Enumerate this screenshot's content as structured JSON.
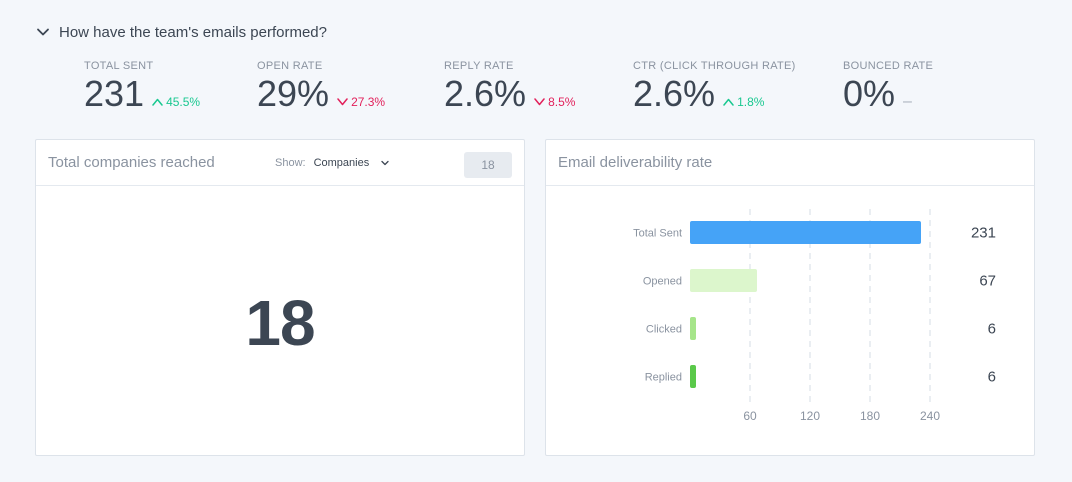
{
  "section": {
    "title": "How have the team's emails performed?",
    "icon": "chevron-down-icon"
  },
  "stats": [
    {
      "label": "TOTAL SENT",
      "value": "231",
      "delta": "45.5%",
      "direction": "up"
    },
    {
      "label": "OPEN RATE",
      "value": "29%",
      "delta": "27.3%",
      "direction": "down"
    },
    {
      "label": "REPLY RATE",
      "value": "2.6%",
      "delta": "8.5%",
      "direction": "down"
    },
    {
      "label": "CTR (CLICK THROUGH RATE)",
      "value": "2.6%",
      "delta": "1.8%",
      "direction": "up"
    },
    {
      "label": "BOUNCED RATE",
      "value": "0%",
      "delta": "–",
      "direction": "flat"
    }
  ],
  "companies_card": {
    "title": "Total companies reached",
    "show_label": "Show:",
    "show_value": "Companies",
    "count": "18",
    "big_number": "18"
  },
  "deliverability_card": {
    "title": "Email deliverability rate"
  },
  "colors": {
    "up": "#19c890",
    "down": "#e2215b",
    "bar_total_sent": "#45a3f7",
    "bar_opened": "#dcf6cc",
    "bar_clicked": "#a6e58a",
    "bar_replied": "#5ac94a"
  },
  "chart_data": {
    "type": "bar",
    "orientation": "horizontal",
    "title": "Email deliverability rate",
    "categories": [
      "Total Sent",
      "Opened",
      "Clicked",
      "Replied"
    ],
    "values": [
      231,
      67,
      6,
      6
    ],
    "value_labels": [
      "231",
      "67",
      "6",
      "6"
    ],
    "colors": [
      "#45a3f7",
      "#dcf6cc",
      "#a6e58a",
      "#5ac94a"
    ],
    "xticks": [
      60,
      120,
      180,
      240
    ],
    "xlim": [
      0,
      240
    ],
    "grid": "vertical-dashed",
    "legend": "none"
  }
}
